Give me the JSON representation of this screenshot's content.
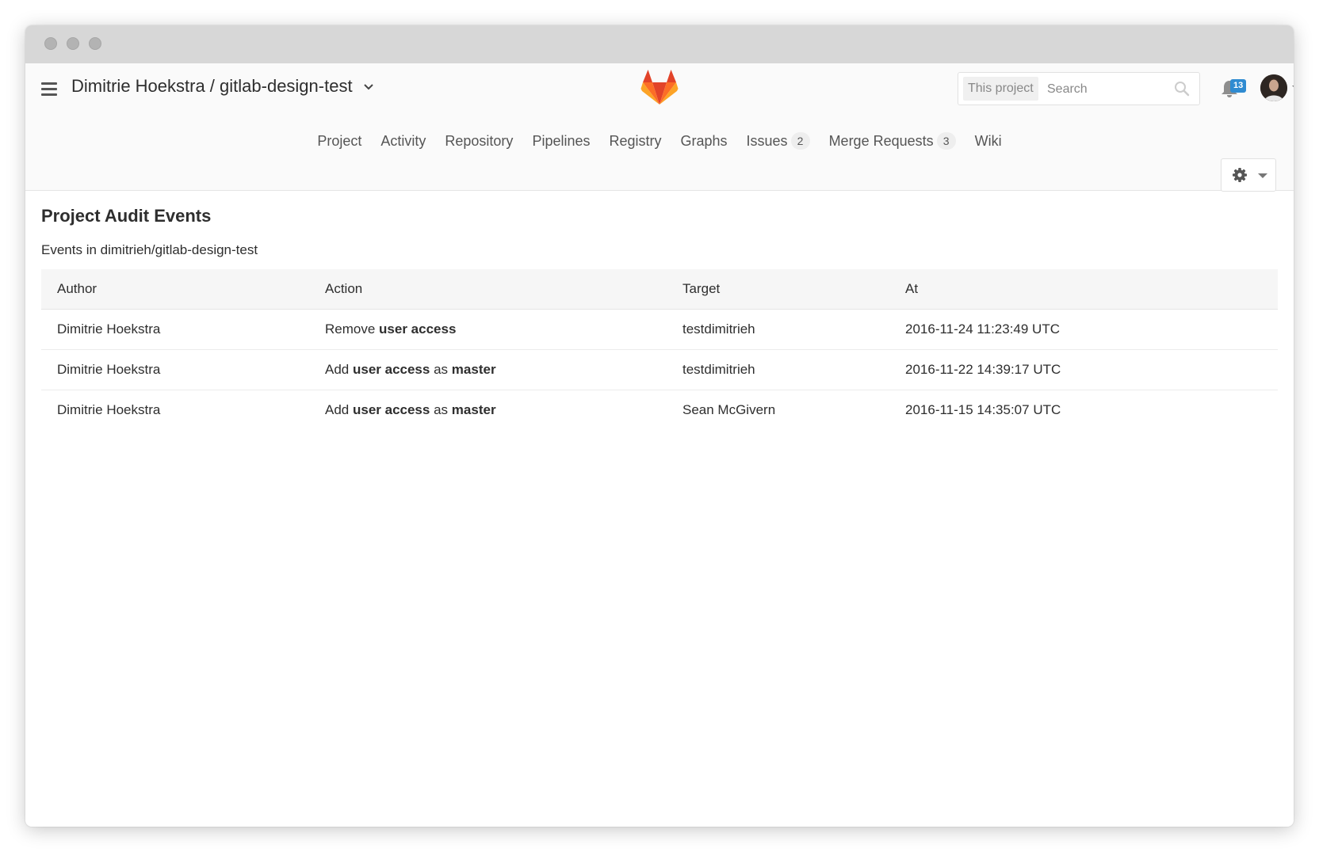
{
  "header": {
    "project_title": "Dimitrie Hoekstra / gitlab-design-test",
    "search_scope": "This project",
    "search_placeholder": "Search",
    "notifications_count": "13"
  },
  "nav": {
    "items": [
      {
        "label": "Project"
      },
      {
        "label": "Activity"
      },
      {
        "label": "Repository"
      },
      {
        "label": "Pipelines"
      },
      {
        "label": "Registry"
      },
      {
        "label": "Graphs"
      },
      {
        "label": "Issues",
        "count": "2"
      },
      {
        "label": "Merge Requests",
        "count": "3"
      },
      {
        "label": "Wiki"
      }
    ]
  },
  "page": {
    "title": "Project Audit Events",
    "subtitle": "Events in dimitrieh/gitlab-design-test"
  },
  "table": {
    "columns": [
      "Author",
      "Action",
      "Target",
      "At"
    ],
    "rows": [
      {
        "author": "Dimitrie Hoekstra",
        "action": {
          "verb": "Remove",
          "object": "user access",
          "sep": "",
          "role": ""
        },
        "target": "testdimitrieh",
        "at": "2016-11-24 11:23:49 UTC"
      },
      {
        "author": "Dimitrie Hoekstra",
        "action": {
          "verb": "Add",
          "object": "user access",
          "sep": "as",
          "role": "master"
        },
        "target": "testdimitrieh",
        "at": "2016-11-22 14:39:17 UTC"
      },
      {
        "author": "Dimitrie Hoekstra",
        "action": {
          "verb": "Add",
          "object": "user access",
          "sep": "as",
          "role": "master"
        },
        "target": "Sean McGivern",
        "at": "2016-11-15 14:35:07 UTC"
      }
    ]
  },
  "icons": {
    "menu": "hamburger-icon",
    "logo": "gitlab-logo",
    "search": "search-icon",
    "notifications": "bell-icon",
    "settings": "gear-icon"
  },
  "colors": {
    "logo_orange": "#e24329",
    "logo_light": "#fca326",
    "logo_mid": "#fc6d26",
    "badge_blue": "#2f8bd1"
  }
}
